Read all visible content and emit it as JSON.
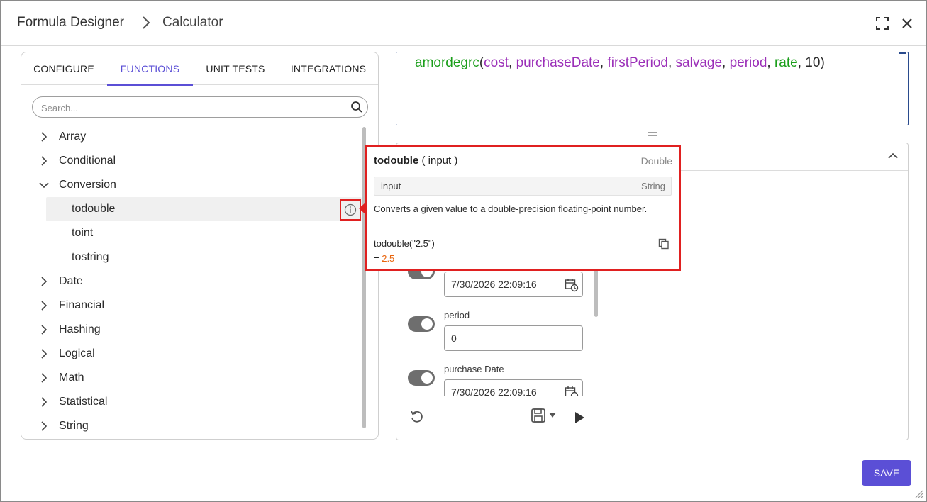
{
  "header": {
    "breadcrumb_root": "Formula Designer",
    "breadcrumb_current": "Calculator"
  },
  "tabs": [
    {
      "label": "CONFIGURE"
    },
    {
      "label": "FUNCTIONS",
      "active": true
    },
    {
      "label": "UNIT TESTS"
    },
    {
      "label": "INTEGRATIONS"
    }
  ],
  "search": {
    "placeholder": "Search..."
  },
  "tree": {
    "categories": [
      "Array",
      "Conditional",
      "Conversion",
      "Date",
      "Financial",
      "Hashing",
      "Logical",
      "Math",
      "Statistical",
      "String"
    ],
    "expanded": "Conversion",
    "conversion_children": [
      "todouble",
      "toint",
      "tostring"
    ],
    "selected": "todouble"
  },
  "editor": {
    "fn": "amordegrc",
    "open": "(",
    "args": [
      "cost",
      "purchaseDate",
      "firstPeriod",
      "salvage",
      "period",
      "rate"
    ],
    "comma": ", ",
    "last_arg": "10",
    "close": ")"
  },
  "params": [
    {
      "label": "",
      "value": "7/30/2026 22:09:16",
      "type": "date"
    },
    {
      "label": "period",
      "value": "0",
      "type": "number"
    },
    {
      "label": "purchase Date",
      "value": "7/30/2026 22:09:16",
      "type": "date"
    }
  ],
  "popover": {
    "name": "todouble",
    "signature": "( input )",
    "return_type": "Double",
    "param_name": "input",
    "param_type": "String",
    "description": "Converts a given value to a double-precision floating-point number.",
    "example": "todouble(\"2.5\")",
    "result_prefix": "= ",
    "result_value": "2.5"
  },
  "footer": {
    "save_label": "SAVE"
  },
  "colors": {
    "accent": "#5b4fd6",
    "highlight": "#e02020",
    "function": "#1a9e1a",
    "variable": "#9b2fb8",
    "result": "#e8640c"
  }
}
